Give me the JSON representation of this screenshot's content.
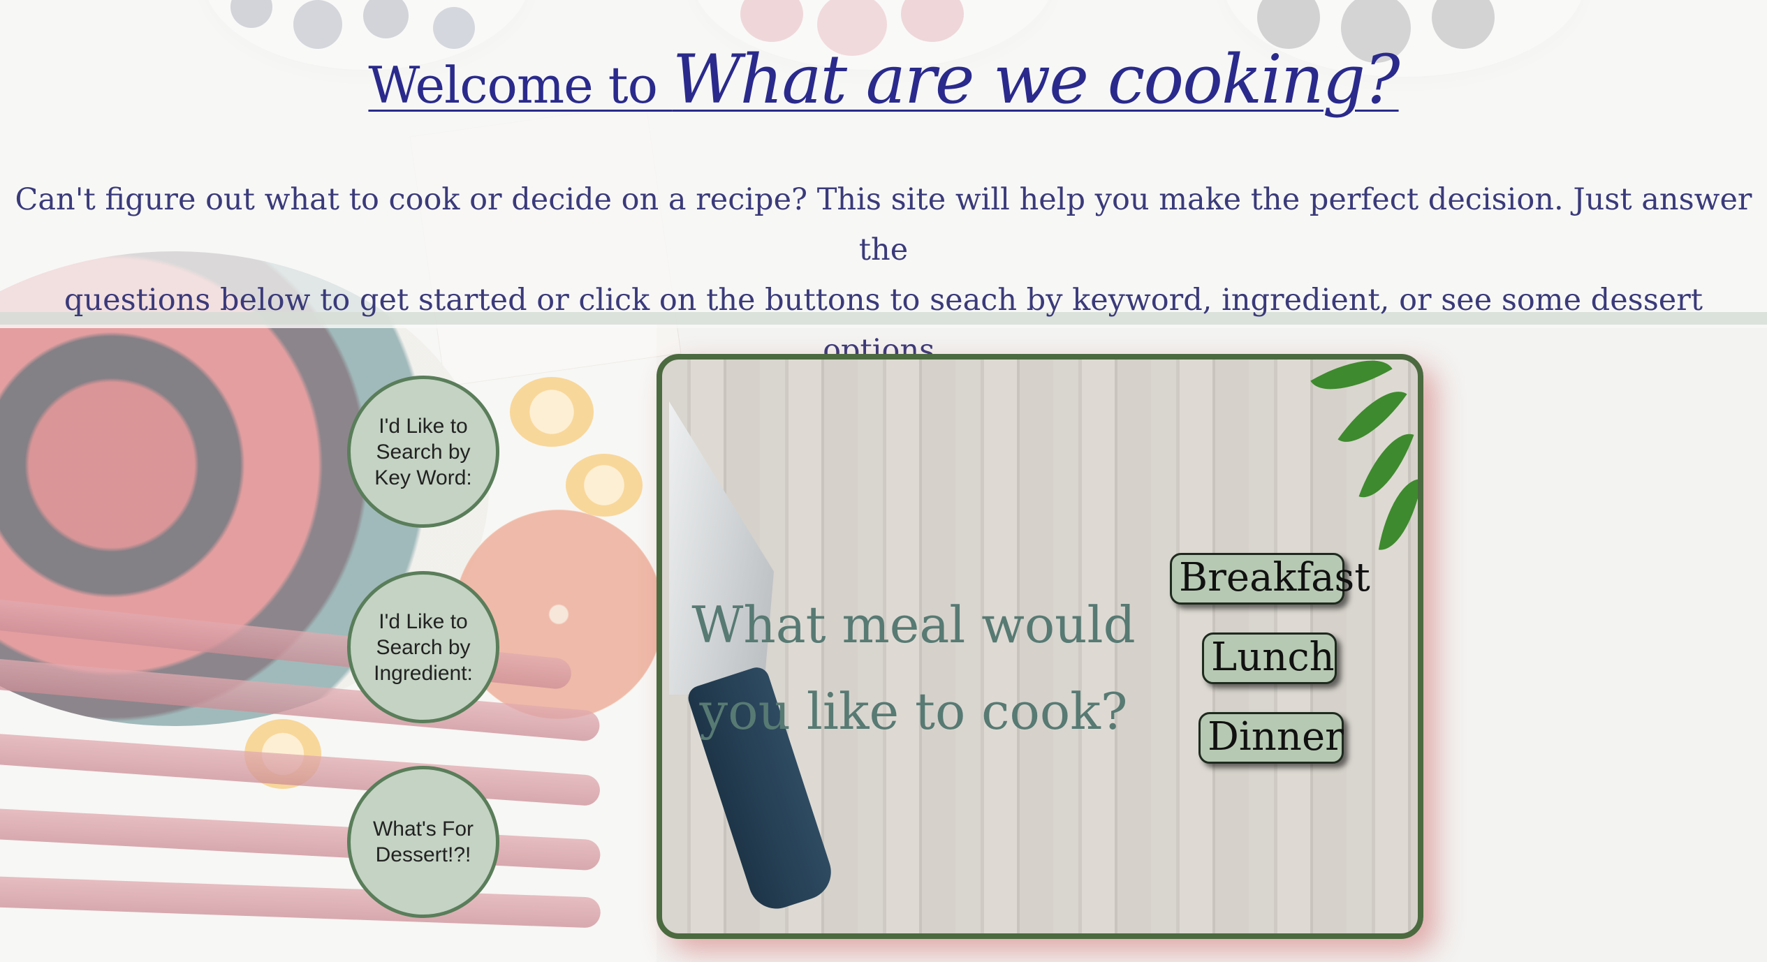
{
  "header": {
    "title_lead": "Welcome to ",
    "title_brand": "What are we cooking?",
    "intro_line1": "Can't figure out what to cook or decide on a recipe? This site will help you make the perfect decision. Just answer the",
    "intro_line2": "questions below to get started or click on the buttons to seach by keyword, ingredient, or see some dessert options."
  },
  "side_buttons": [
    {
      "line1": "I'd Like to",
      "line2": "Search by",
      "line3": "Key Word:"
    },
    {
      "line1": "I'd Like to",
      "line2": "Search by",
      "line3": "Ingredient:"
    },
    {
      "line1": "What's For",
      "line2": "Dessert!?!"
    }
  ],
  "meal_card": {
    "question_line1": "What meal would",
    "question_line2": "you like to cook?",
    "options": [
      "Breakfast",
      "Lunch",
      "Dinner"
    ]
  },
  "colors": {
    "title": "#2a2a8c",
    "intro_text": "#3a3a7a",
    "button_fill": "#c4d3c3",
    "button_border": "#5a7d5a",
    "card_border": "#4b6a3f",
    "meal_button_fill": "#b6c9b2",
    "question_text": "#577a73"
  },
  "icons": [
    "knife-image",
    "leaves-image",
    "berry-bowls-image",
    "fruit-background-image"
  ]
}
